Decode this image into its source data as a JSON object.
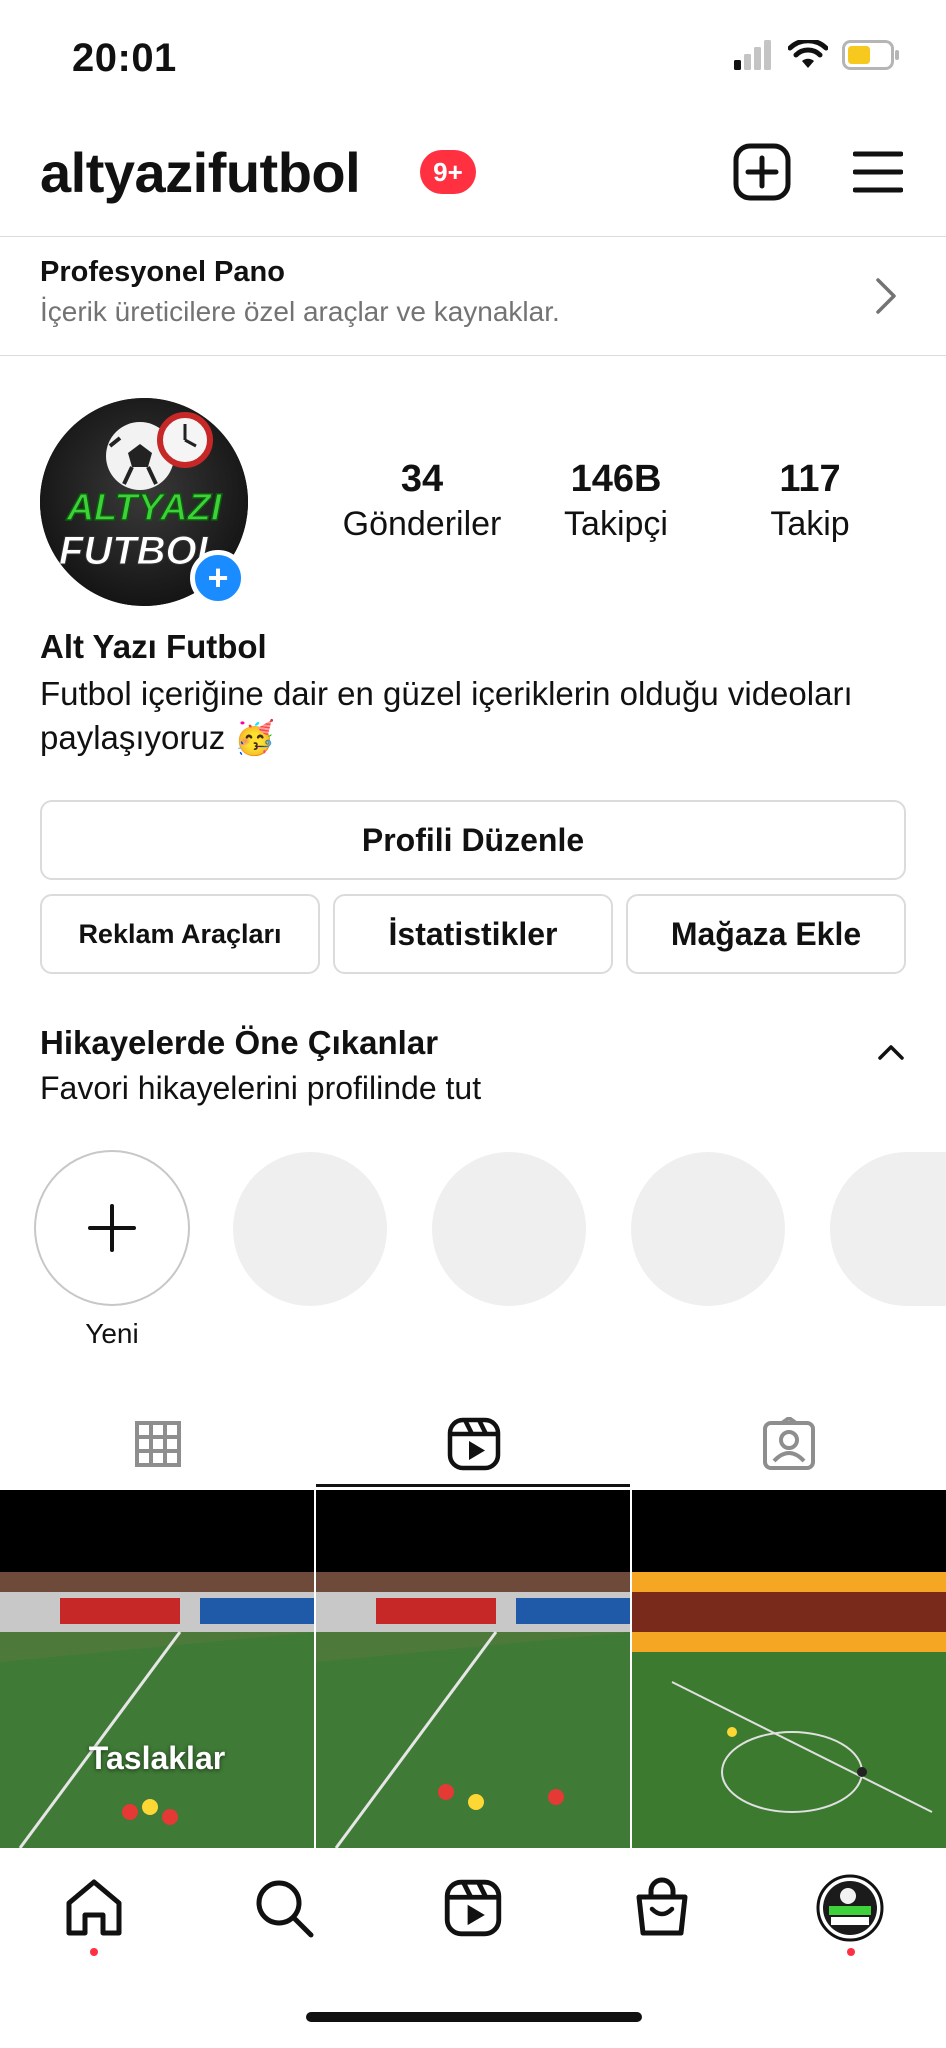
{
  "status_bar": {
    "time": "20:01"
  },
  "header": {
    "username": "altyazifutbol",
    "notification_badge": "9+"
  },
  "professional_dashboard": {
    "title": "Profesyonel Pano",
    "subtitle": "İçerik üreticilere özel araçlar ve kaynaklar."
  },
  "profile": {
    "avatar_text_line1": "ALTYAZI",
    "avatar_text_line2": "FUTBOL",
    "stats": [
      {
        "value": "34",
        "label": "Gönderiler"
      },
      {
        "value": "146B",
        "label": "Takipçi"
      },
      {
        "value": "117",
        "label": "Takip"
      }
    ],
    "full_name": "Alt Yazı Futbol",
    "bio": "Futbol içeriğine dair en güzel içeriklerin olduğu videoları paylaşıyoruz 🥳"
  },
  "buttons": {
    "edit_profile": "Profili Düzenle",
    "ad_tools": "Reklam Araçları",
    "insights": "İstatistikler",
    "add_shop": "Mağaza Ekle"
  },
  "highlights": {
    "title": "Hikayelerde Öne Çıkanlar",
    "subtitle": "Favori hikayelerini profilinde tut",
    "new_label": "Yeni"
  },
  "tabs": [
    {
      "icon": "grid-icon",
      "active": false
    },
    {
      "icon": "reels-icon",
      "active": true
    },
    {
      "icon": "tagged-icon",
      "active": false
    }
  ],
  "grid": {
    "drafts_label": "Taslaklar"
  },
  "colors": {
    "badge": "#ff3040",
    "add_story": "#1a8cff",
    "border": "#dbdbdb",
    "placeholder": "#efefef"
  },
  "bottom_nav": [
    {
      "icon": "home-icon",
      "active_dot": true
    },
    {
      "icon": "search-icon",
      "active_dot": false
    },
    {
      "icon": "reels-icon",
      "active_dot": false
    },
    {
      "icon": "shop-icon",
      "active_dot": false
    },
    {
      "icon": "profile-avatar",
      "active_dot": true
    }
  ]
}
